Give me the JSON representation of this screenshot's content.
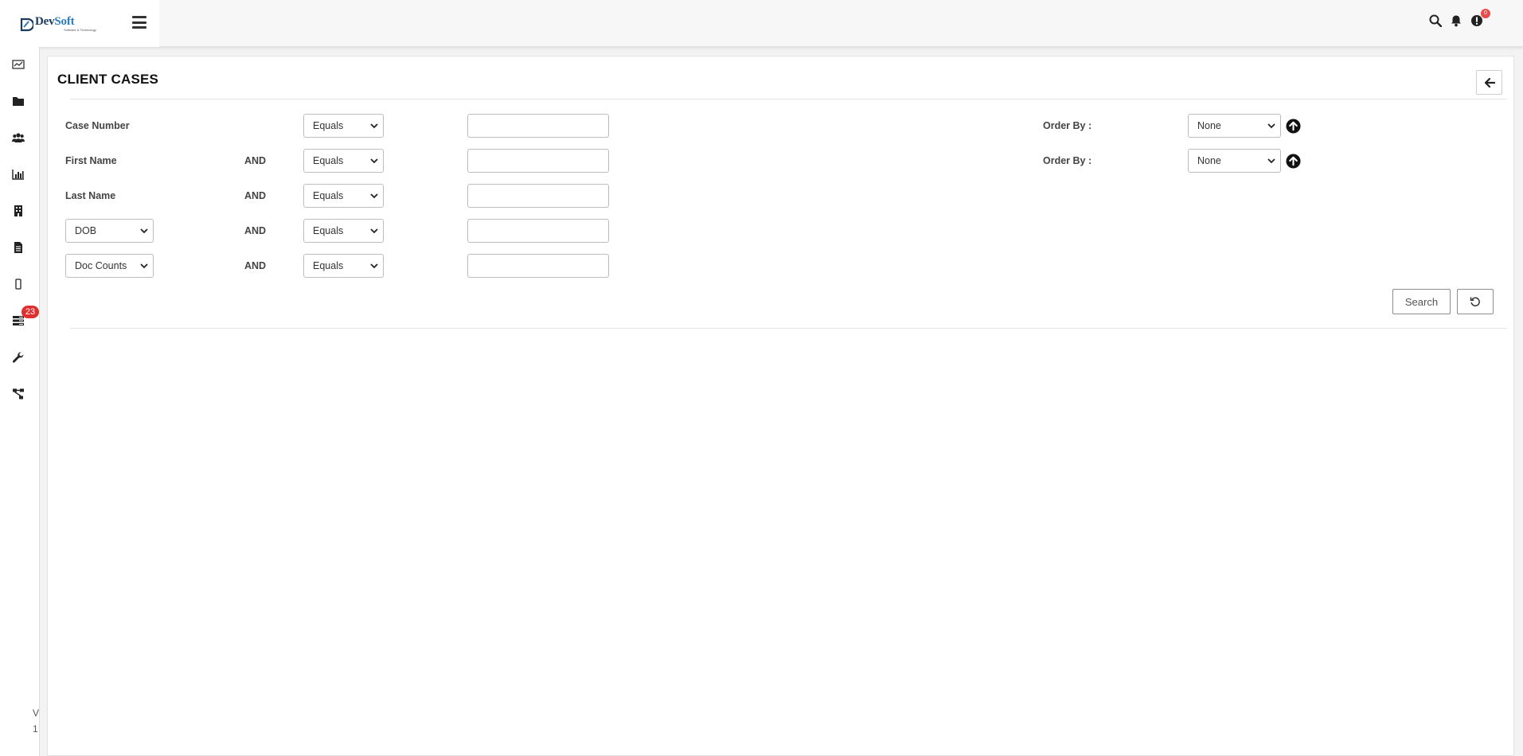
{
  "brand": {
    "name_dev": "Dev",
    "name_soft": "Soft",
    "tagline": "Software & Technology"
  },
  "topbar": {
    "icons": [
      "search-icon",
      "bell-icon",
      "alert-icon"
    ],
    "alert_count": "0"
  },
  "sidebar": {
    "items": [
      {
        "icon": "dashboard-icon"
      },
      {
        "icon": "folder-icon"
      },
      {
        "icon": "users-icon"
      },
      {
        "icon": "bar-chart-icon"
      },
      {
        "icon": "building-icon"
      },
      {
        "icon": "document-icon"
      },
      {
        "icon": "mobile-icon"
      },
      {
        "icon": "tasks-icon",
        "badge": "23"
      },
      {
        "icon": "wrench-icon"
      },
      {
        "icon": "sitemap-icon"
      }
    ],
    "version_line1": "V",
    "version_line2": "1"
  },
  "page": {
    "title": "CLIENT CASES"
  },
  "filters": {
    "rows": [
      {
        "field": "Case Number",
        "connector": "",
        "operator": "Equals",
        "value": ""
      },
      {
        "field": "First Name",
        "connector": "AND",
        "operator": "Equals",
        "value": ""
      },
      {
        "field": "Last Name",
        "connector": "AND",
        "operator": "Equals",
        "value": ""
      },
      {
        "field": "DOB",
        "connector": "AND",
        "operator": "Equals",
        "value": ""
      },
      {
        "field": "Doc Counts",
        "connector": "AND",
        "operator": "Equals",
        "value": ""
      }
    ],
    "order_by": [
      {
        "label": "Order By :",
        "value": "None"
      },
      {
        "label": "Order By :",
        "value": "None"
      }
    ],
    "search_label": "Search"
  },
  "colors": {
    "badge": "#e02f2f",
    "accent": "#2a7bc0"
  }
}
